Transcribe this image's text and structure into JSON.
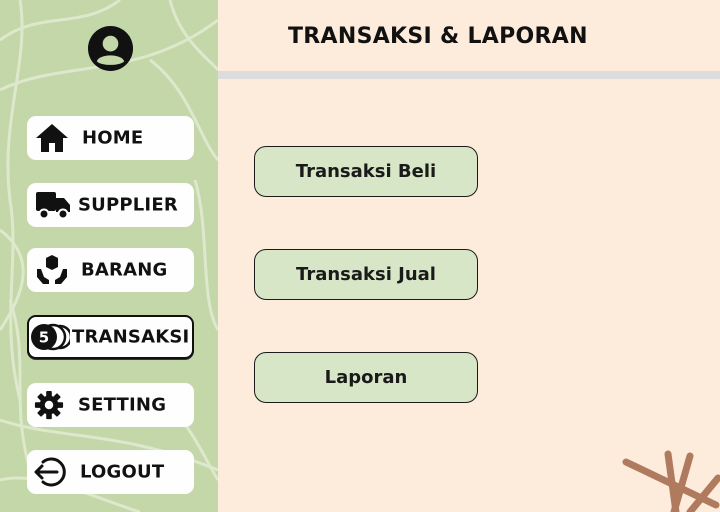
{
  "sidebar": {
    "avatar_icon": "user-circle-icon",
    "items": [
      {
        "label": "HOME",
        "icon": "home-icon"
      },
      {
        "label": "SUPPLIER",
        "icon": "truck-icon"
      },
      {
        "label": "BARANG",
        "icon": "box-hands-icon"
      },
      {
        "label": "TRANSAKSI",
        "icon": "coins-icon",
        "icon_text": "5",
        "active": true
      },
      {
        "label": "SETTING",
        "icon": "gear-icon"
      },
      {
        "label": "LOGOUT",
        "icon": "logout-icon"
      }
    ]
  },
  "header": {
    "title": "TRANSAKSI & LAPORAN"
  },
  "main": {
    "buttons": [
      {
        "label": "Transaksi Beli"
      },
      {
        "label": "Transaksi Jual"
      },
      {
        "label": "Laporan"
      }
    ]
  },
  "colors": {
    "sidebar_bg": "#c4d7a8",
    "main_bg": "#fdebdc",
    "button_bg": "#d7e6c6",
    "divider": "#dcdcdc",
    "deco_stroke": "#b07a5f"
  }
}
